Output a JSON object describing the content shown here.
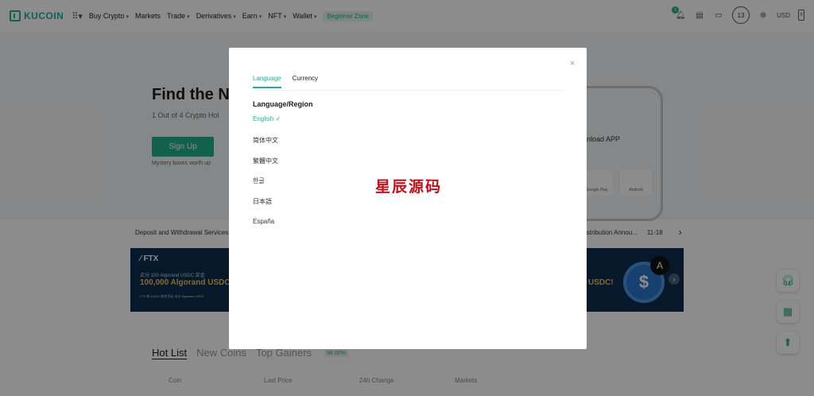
{
  "header": {
    "brand": "KUCOIN",
    "nav": [
      "Buy Crypto",
      "Markets",
      "Trade",
      "Derivatives",
      "Earn",
      "NFT",
      "Wallet"
    ],
    "nav_caret": [
      "▾",
      "",
      "▾",
      "▾",
      "▾",
      "▾",
      "▾"
    ],
    "beginner_zone": "Beginner Zone",
    "notification_count": "1",
    "user_badge": "13",
    "currency": "USD",
    "currency_box": "8"
  },
  "hero": {
    "title": "Find the N",
    "subtitle": "1 Out of 4 Crypto Hol",
    "signup_label": "Sign Up",
    "mystery_text": "Mystery boxes worth up",
    "download_text": "nload APP",
    "google_play": "Google Play",
    "android": "Android"
  },
  "ticker": {
    "left_text": "Deposit and Withdrawal Services r",
    "right_text": "istribution Annou...",
    "right_date": "11-18",
    "arrow": "›"
  },
  "banner": {
    "brand": "⁄ FTX",
    "line1": "瓜分 100 Algorand USDC 奖金",
    "line2": "100,000 Algorand USDC",
    "line3": "FTX 和 USDC 联合活动 瓜分 Algorand USDC",
    "right_text": "USDC!",
    "coin_symbol": "$",
    "coin_badge": "A",
    "arrow": "›"
  },
  "markets": {
    "tabs": [
      "Hot List",
      "New Coins",
      "Top Gainers"
    ],
    "gainer_pct": "98.00%",
    "columns": [
      "Coin",
      "Last Price",
      "24h Change",
      "Markets"
    ]
  },
  "modal": {
    "close": "×",
    "tabs": [
      "Language",
      "Currency"
    ],
    "section_title": "Language/Region",
    "languages": [
      "English ✓",
      "简体中文",
      "繁體中文",
      "한글",
      "日本語",
      "España"
    ]
  },
  "watermark": "星辰源码",
  "colors": {
    "accent": "#23af91",
    "overlay": "rgba(0,0,0,0.45)",
    "banner_bg": "#0d2d4e",
    "watermark": "#c0121c"
  }
}
